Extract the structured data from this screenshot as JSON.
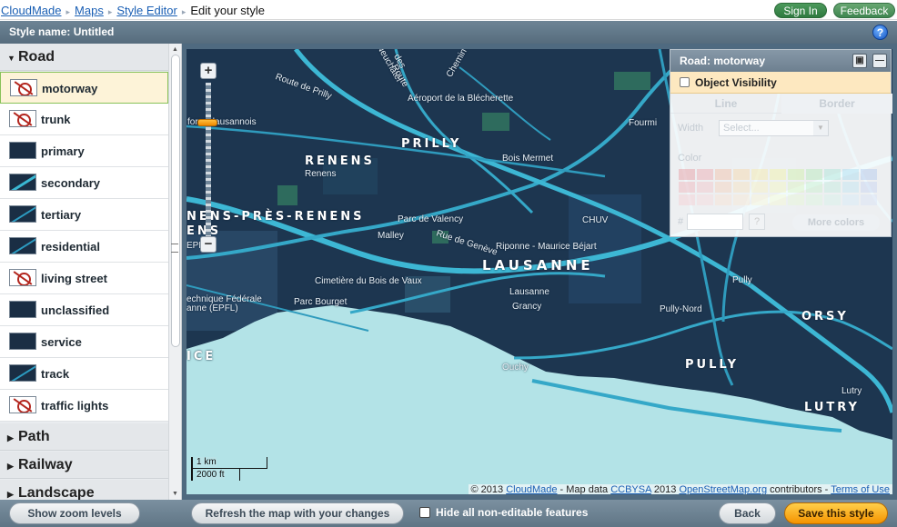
{
  "breadcrumb": {
    "items": [
      "CloudMade",
      "Maps",
      "Style Editor"
    ],
    "separator": "▸",
    "current": "Edit your style"
  },
  "header": {
    "signin_label": "Sign In",
    "feedback_label": "Feedback"
  },
  "titlebar": {
    "style_name": "Style name: Untitled",
    "help_label": "?"
  },
  "sidebar": {
    "sections": [
      {
        "label": "Road",
        "expanded": true
      },
      {
        "label": "Path",
        "expanded": false
      },
      {
        "label": "Railway",
        "expanded": false
      },
      {
        "label": "Landscape",
        "expanded": false
      }
    ],
    "road_items": [
      {
        "label": "motorway",
        "icon": "hidden-icon",
        "selected": true
      },
      {
        "label": "trunk",
        "icon": "hidden-icon"
      },
      {
        "label": "primary",
        "icon": "plain-swatch-icon"
      },
      {
        "label": "secondary",
        "icon": "diagonal-swatch-icon"
      },
      {
        "label": "tertiary",
        "icon": "diagonal-swatch-icon"
      },
      {
        "label": "residential",
        "icon": "diagonal-swatch-icon"
      },
      {
        "label": "living street",
        "icon": "hidden-icon"
      },
      {
        "label": "unclassified",
        "icon": "plain-swatch-icon"
      },
      {
        "label": "service",
        "icon": "plain-swatch-icon"
      },
      {
        "label": "track",
        "icon": "diagonal-swatch-icon"
      },
      {
        "label": "traffic lights",
        "icon": "hidden-icon"
      }
    ]
  },
  "map": {
    "zoom_in": "+",
    "zoom_out": "−",
    "labels": {
      "prilly": "PRILLY",
      "renens_caps": "RENENS",
      "renens": "Renens",
      "lausanne": "LAUSANNE",
      "pully": "PULLY",
      "lutry": "LUTRY",
      "orsy": "ORSY",
      "nens_pres_renens": "NENS-PRÈS-RENENS",
      "ens": "ENS",
      "ice": "ICE",
      "aeroport": "Aéroport de la Blécherette",
      "bois_mermet": "Bois Mermet",
      "parc_valency": "Parc de Valency",
      "malley": "Malley",
      "rue_geneve": "Rue de Genève",
      "riponne": "Riponne - Maurice Béjart",
      "cimetiere": "Cimetière du Bois de Vaux",
      "parc_bourget": "Parc Bourget",
      "lausanne_small": "Lausanne",
      "grancy": "Grancy",
      "ouchy": "Ouchy",
      "pully_nord": "Pully-Nord",
      "pully_small": "Pully",
      "lutry_small": "Lutry",
      "chuv": "CHUV",
      "fourmi": "Fourmi",
      "forest": "forest lausannois",
      "polytech1": "echnique Fédérale",
      "polytech2": "anne (EPFL)",
      "rte_prilly": "Route de Prilly",
      "neuchatel": "Neuchâtel",
      "chemin": "Chemin",
      "route": "Route",
      "epfl_side": "EPFL",
      "des": "des"
    },
    "scale": {
      "km": "1 km",
      "ft": "2000 ft"
    },
    "credits": {
      "prefix": "© 2013",
      "cloudmade": "CloudMade",
      "mapdata": "- Map data",
      "ccbysa": "CCBYSA",
      "year": "2013",
      "osm": "OpenStreetMap.org",
      "contributors": "contributors -",
      "terms": "Terms of Use"
    }
  },
  "style_panel": {
    "title": "Road: motorway",
    "visibility_label": "Object Visibility",
    "visibility_checked": false,
    "tabs": [
      "Line",
      "Border"
    ],
    "width_label": "Width",
    "width_placeholder": "Select...",
    "color_label": "Color",
    "hex_label": "#",
    "hex_help": "?",
    "more_colors": "More colors",
    "palette": [
      "#e89aa0",
      "#eeaab0",
      "#f2c0a8",
      "#f6d6a8",
      "#f8eaa8",
      "#f2f4a6",
      "#d0f0a8",
      "#b4eab8",
      "#aae6d8",
      "#a8dcef",
      "#b0c8ee",
      "#f0b4bc",
      "#f3c3c8",
      "#f5d2bc",
      "#f7e2bf",
      "#f9f0c0",
      "#f5f7c0",
      "#dcf4c0",
      "#c8f0cc",
      "#c2ecdf",
      "#c0e4f3",
      "#c6d4f2",
      "#f6cfd4",
      "#f8d9dd",
      "#f9e2d4",
      "#fae9d4",
      "#fbf5d6",
      "#f8fad4",
      "#e8f8d6",
      "#dcf6de",
      "#d6f2ea",
      "#d6ecf8",
      "#d9e2f6"
    ],
    "gray_palette": [
      "#c8c8c8",
      "#d8d8d8",
      "#b8b8b8"
    ]
  },
  "bottom": {
    "show_zoom": "Show zoom levels",
    "refresh": "Refresh the map with your changes",
    "hide_label": "Hide all non-editable features",
    "back": "Back",
    "save": "Save this style"
  }
}
